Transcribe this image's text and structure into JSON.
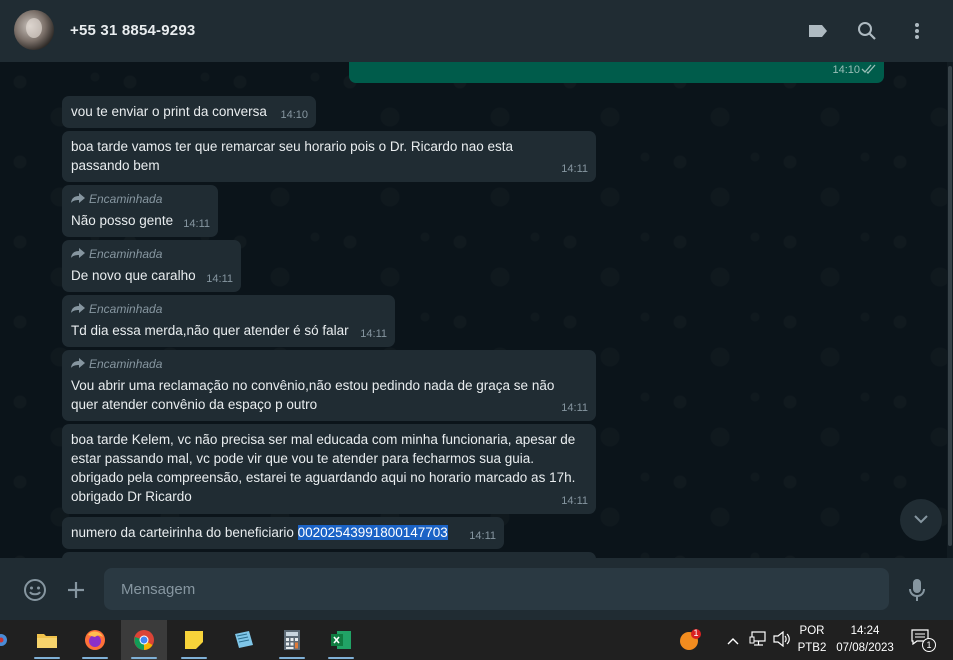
{
  "header": {
    "contact_name": "+55 31 8854-9293",
    "icons": [
      "label-icon",
      "search-icon",
      "more-vert-icon"
    ]
  },
  "messages": [
    {
      "type": "out",
      "text": "",
      "time": "14:10",
      "status": "read"
    },
    {
      "type": "in",
      "text": "vou te enviar o print da conversa",
      "time": "14:10"
    },
    {
      "type": "in",
      "text": "boa tarde vamos ter que remarcar seu horario pois o Dr. Ricardo nao esta passando bem",
      "time": "14:11"
    },
    {
      "type": "in",
      "forwarded": "Encaminhada",
      "text": "Não posso gente",
      "time": "14:11"
    },
    {
      "type": "in",
      "forwarded": "Encaminhada",
      "text": "De novo que caralho",
      "time": "14:11"
    },
    {
      "type": "in",
      "forwarded": "Encaminhada",
      "text": "Td dia essa merda,não quer atender é só falar",
      "time": "14:11"
    },
    {
      "type": "in",
      "forwarded": "Encaminhada",
      "text": "Vou abrir uma reclamação no convênio,não estou pedindo nada de graça se não quer atender convênio da espaço p outro",
      "time": "14:11"
    },
    {
      "type": "in",
      "text": "boa tarde Kelem, vc não precisa ser mal educada com minha funcionaria, apesar de estar passando mal, vc pode vir que vou te atender para fecharmos sua guia. obrigado pela compreensão, estarei te aguardando aqui no horario marcado as 17h. obrigado Dr Ricardo",
      "time": "14:11"
    },
    {
      "type": "in",
      "text": "numero da carteirinha do beneficiario ",
      "highlight": "00202543991800147703",
      "time": "14:11"
    }
  ],
  "composer": {
    "placeholder": "Mensagem",
    "icons": [
      "emoji-icon",
      "attach-plus-icon",
      "microphone-icon"
    ]
  },
  "taskbar": {
    "apps": [
      "settings-app-icon",
      "file-explorer-icon",
      "firefox-icon",
      "chrome-icon",
      "sticky-notes-icon",
      "notepad-icon",
      "calculator-icon",
      "excel-icon"
    ],
    "notification_badge": "1",
    "language": "POR",
    "keyboard": "PTB2",
    "time": "14:24",
    "date": "07/08/2023",
    "action_center_badge": "1"
  },
  "colors": {
    "header_bg": "#202c33",
    "chat_bg": "#0b141a",
    "incoming_bubble": "#202c33",
    "outgoing_bubble": "#005c4b",
    "highlight": "#1b63c6"
  }
}
